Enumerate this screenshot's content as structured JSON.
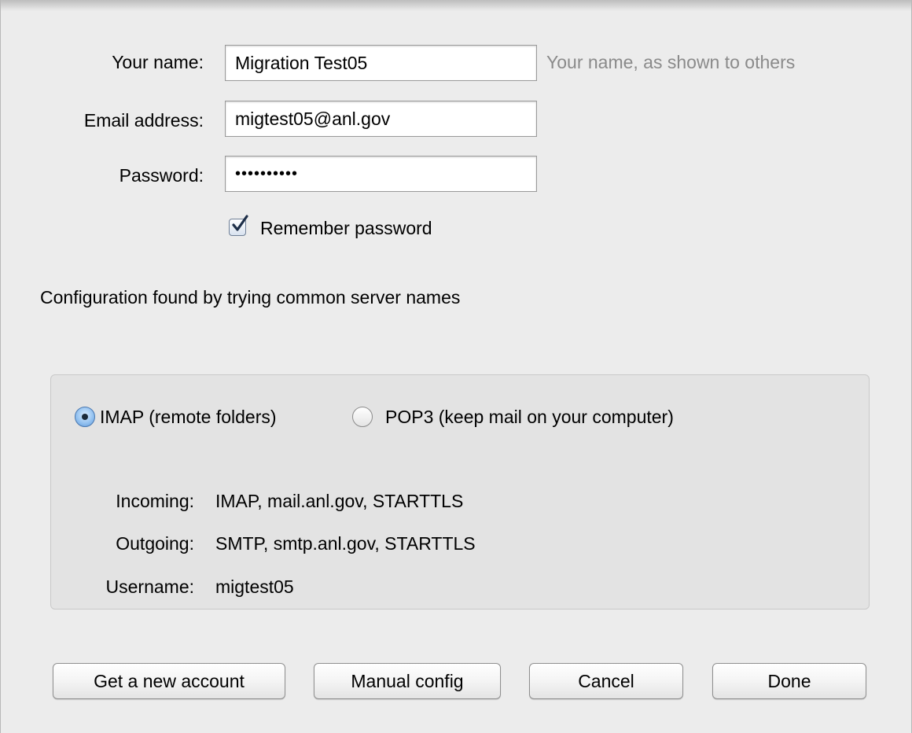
{
  "form": {
    "name_label": "Your name:",
    "name_value": "Migration Test05",
    "name_hint": "Your name, as shown to others",
    "email_label": "Email address:",
    "email_value": "migtest05@anl.gov",
    "password_label": "Password:",
    "password_value": "••••••••••",
    "remember_label": "Remember password",
    "remember_checked": true
  },
  "status": {
    "message": "Configuration found by trying common server names"
  },
  "config": {
    "protocol_options": [
      {
        "label": "IMAP (remote folders)",
        "selected": true
      },
      {
        "label": "POP3 (keep mail on your computer)",
        "selected": false
      }
    ],
    "incoming_label": "Incoming:",
    "incoming_value": "IMAP, mail.anl.gov, STARTTLS",
    "outgoing_label": "Outgoing:",
    "outgoing_value": "SMTP, smtp.anl.gov, STARTTLS",
    "username_label": "Username:",
    "username_value": "migtest05"
  },
  "buttons": {
    "get_account": "Get a new account",
    "manual_config": "Manual config",
    "cancel": "Cancel",
    "done": "Done"
  },
  "colors": {
    "window_bg": "#ececec",
    "panel_bg": "#e3e3e3",
    "hint_text": "#8a8a8a",
    "radio_selected": "#5c95d6"
  }
}
